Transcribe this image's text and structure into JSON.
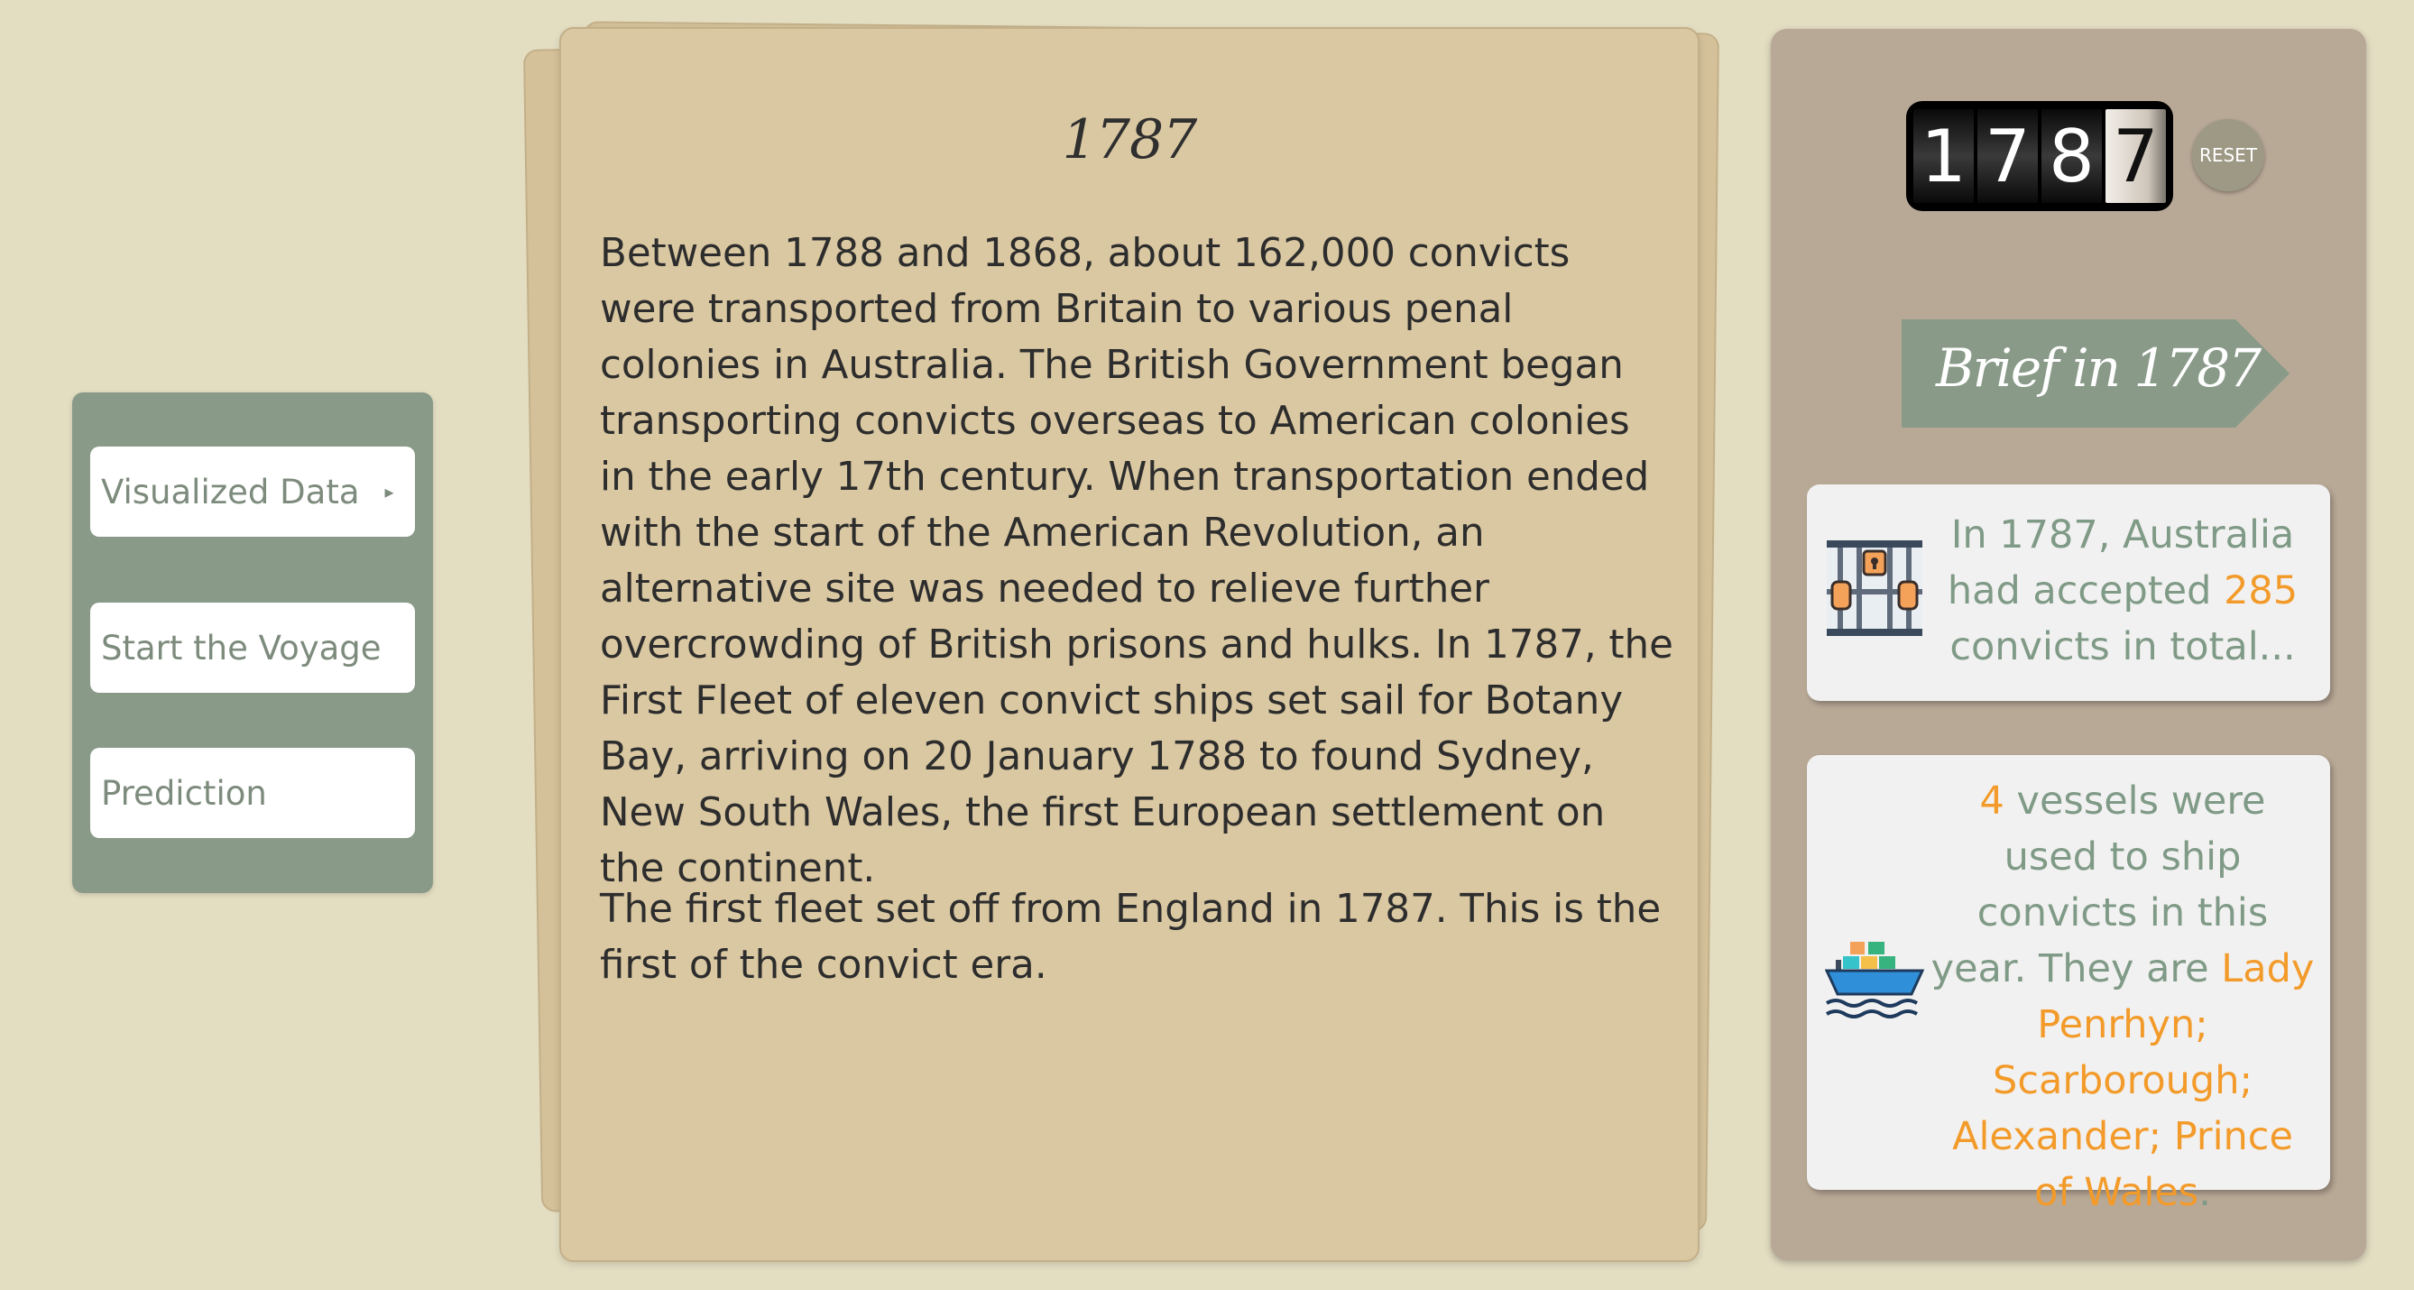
{
  "menu": {
    "items": [
      {
        "label": "Visualized Data",
        "caret": "▸"
      },
      {
        "label": "Start the Voyage"
      },
      {
        "label": "Prediction"
      }
    ]
  },
  "paper": {
    "title": "1787",
    "paragraph1": "Between 1788 and 1868, about 162,000 convicts were transported from Britain to various penal colonies in Australia. The British Government began transporting convicts overseas to American colonies in the early 17th century. When transportation ended with the start of the American Revolution, an alternative site was needed to relieve further overcrowding of British prisons and hulks. In 1787, the First Fleet of eleven convict ships set sail for Botany Bay, arriving on 20 January 1788 to found Sydney, New South Wales, the first European settlement on the continent.",
    "paragraph2": "The first fleet set off from England in 1787. This is the first of the convict era."
  },
  "sidebar": {
    "year_digits": [
      "1",
      "7",
      "8",
      "7"
    ],
    "reset_label": "RESET",
    "brief_title": "Brief in 1787",
    "card1": {
      "icon": "prison-icon",
      "text_before": "In 1787, Australia had accepted ",
      "count": "285",
      "text_after": " convicts in total..."
    },
    "card2": {
      "icon": "ship-icon",
      "count": "4",
      "text_middle": " vessels were used to ship convicts in this year. They are ",
      "ships": "Lady Penrhyn; Scarborough; Alexander; Prince of Wales",
      "period": "."
    }
  },
  "colors": {
    "background": "#e3ddc2",
    "menu": "#899a89",
    "paper": "#dac8a2",
    "sidebar": "#b8a896",
    "banner": "#899a89",
    "card_text": "#7f9a86",
    "highlight": "#f39b2a"
  }
}
